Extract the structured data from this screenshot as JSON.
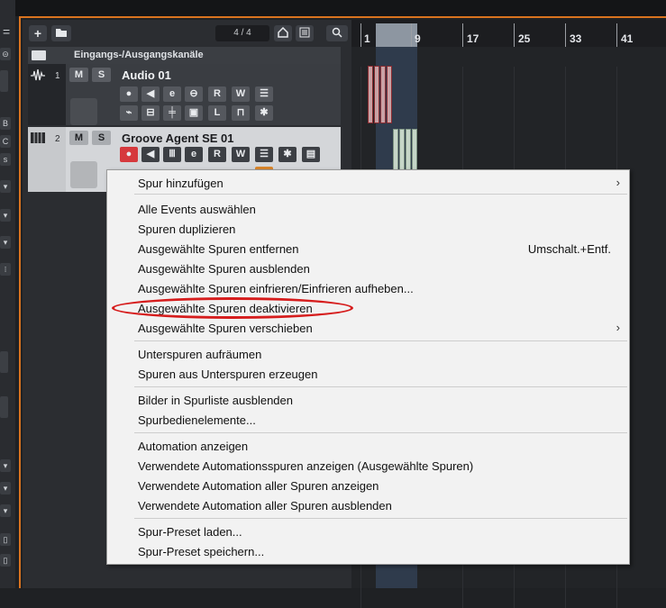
{
  "toolbar": {
    "add_icon": "+",
    "counter": "4 / 4"
  },
  "io_header": {
    "title": "Eingangs-/Ausgangskanäle"
  },
  "tracks": [
    {
      "num": "1",
      "name": "Audio 01",
      "mute": "M",
      "solo": "S",
      "read": "R",
      "write": "W",
      "l": "L"
    },
    {
      "num": "2",
      "name": "Groove Agent SE 01",
      "mute": "M",
      "solo": "S",
      "read": "R",
      "write": "W"
    }
  ],
  "ruler": {
    "labels": [
      "1",
      "9",
      "17",
      "25",
      "33",
      "41"
    ]
  },
  "left_strip": {
    "labels": [
      "B",
      "C",
      "s"
    ]
  },
  "menu": {
    "items": [
      {
        "label": "Spur hinzufügen",
        "submenu": true
      },
      {
        "label": "Alle Events auswählen"
      },
      {
        "label": "Spuren duplizieren"
      },
      {
        "label": "Ausgewählte Spuren entfernen",
        "shortcut": "Umschalt.+Entf."
      },
      {
        "label": "Ausgewählte Spuren ausblenden"
      },
      {
        "label": "Ausgewählte Spuren einfrieren/Einfrieren aufheben..."
      },
      {
        "label": "Ausgewählte Spuren deaktivieren"
      },
      {
        "label": "Ausgewählte Spuren verschieben",
        "submenu": true
      },
      {
        "label": "Unterspuren aufräumen"
      },
      {
        "label": "Spuren aus Unterspuren erzeugen"
      },
      {
        "label": "Bilder in Spurliste ausblenden"
      },
      {
        "label": "Spurbedienelemente..."
      },
      {
        "label": "Automation anzeigen"
      },
      {
        "label": "Verwendete Automationsspuren anzeigen (Ausgewählte Spuren)"
      },
      {
        "label": "Verwendete Automation aller Spuren anzeigen"
      },
      {
        "label": "Verwendete Automation aller Spuren ausblenden"
      },
      {
        "label": "Spur-Preset laden..."
      },
      {
        "label": "Spur-Preset speichern..."
      }
    ]
  },
  "colors": {
    "accent": "#d9731f",
    "highlight_oval": "#d61d1d",
    "record": "#d6393d"
  }
}
